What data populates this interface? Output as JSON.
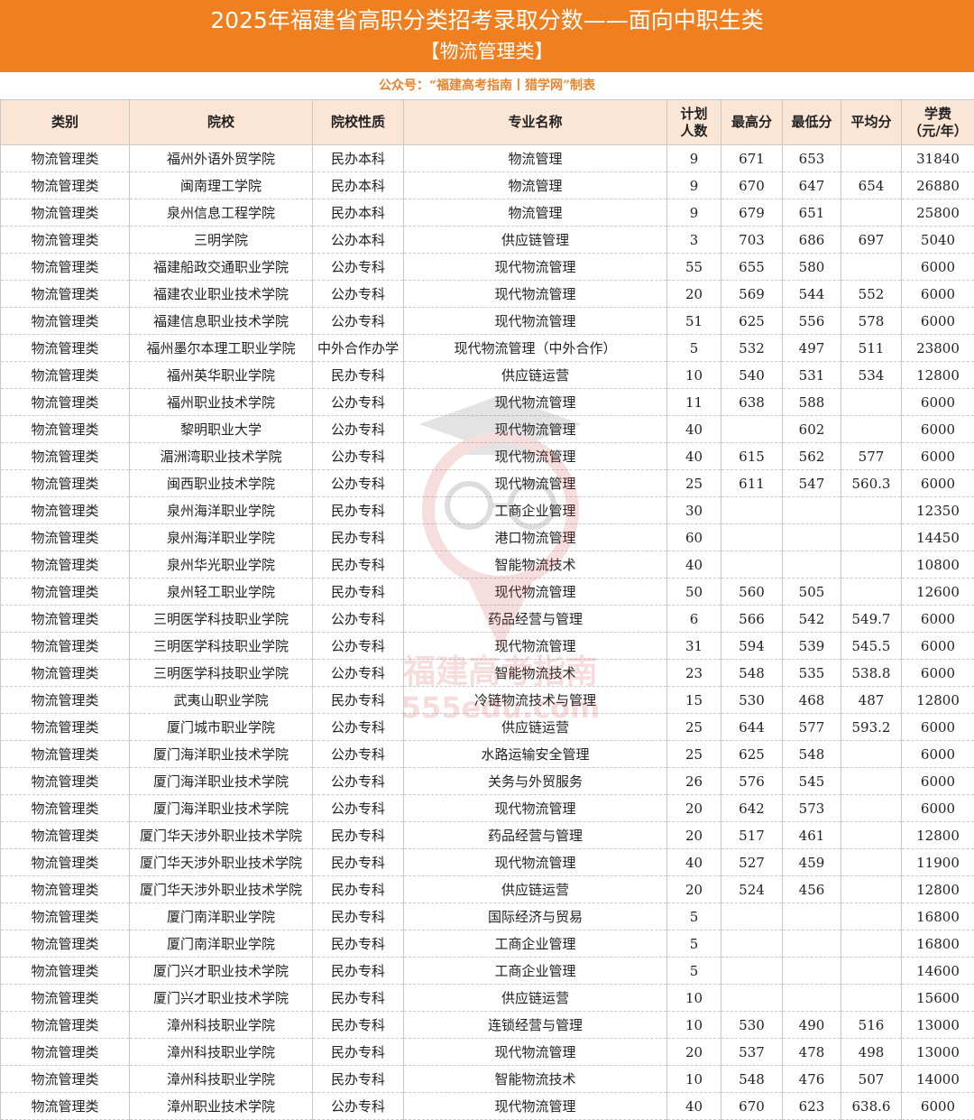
{
  "banner": {
    "title": "2025年福建省高职分类招考录取分数——面向中职生类",
    "subtitle": "【物流管理类】"
  },
  "credit": "公众号：“福建高考指南丨猎学网”制表",
  "watermark": {
    "line1": "福建高考指南",
    "line2": "555edu.com"
  },
  "table": {
    "headers": [
      "类别",
      "院校",
      "院校性质",
      "专业名称",
      "计划\n人数",
      "最高分",
      "最低分",
      "平均分",
      "学费\n（元/年）"
    ],
    "rows": [
      [
        "物流管理类",
        "福州外语外贸学院",
        "民办本科",
        "物流管理",
        "9",
        "671",
        "653",
        "",
        "31840"
      ],
      [
        "物流管理类",
        "闽南理工学院",
        "民办本科",
        "物流管理",
        "9",
        "670",
        "647",
        "654",
        "26880"
      ],
      [
        "物流管理类",
        "泉州信息工程学院",
        "民办本科",
        "物流管理",
        "9",
        "679",
        "651",
        "",
        "25800"
      ],
      [
        "物流管理类",
        "三明学院",
        "公办本科",
        "供应链管理",
        "3",
        "703",
        "686",
        "697",
        "5040"
      ],
      [
        "物流管理类",
        "福建船政交通职业学院",
        "公办专科",
        "现代物流管理",
        "55",
        "655",
        "580",
        "",
        "6000"
      ],
      [
        "物流管理类",
        "福建农业职业技术学院",
        "公办专科",
        "现代物流管理",
        "20",
        "569",
        "544",
        "552",
        "6000"
      ],
      [
        "物流管理类",
        "福建信息职业技术学院",
        "公办专科",
        "现代物流管理",
        "51",
        "625",
        "556",
        "578",
        "6000"
      ],
      [
        "物流管理类",
        "福州墨尔本理工职业学院",
        "中外合作办学",
        "现代物流管理（中外合作）",
        "5",
        "532",
        "497",
        "511",
        "23800"
      ],
      [
        "物流管理类",
        "福州英华职业学院",
        "民办专科",
        "供应链运营",
        "10",
        "540",
        "531",
        "534",
        "12800"
      ],
      [
        "物流管理类",
        "福州职业技术学院",
        "公办专科",
        "现代物流管理",
        "11",
        "638",
        "588",
        "",
        "6000"
      ],
      [
        "物流管理类",
        "黎明职业大学",
        "公办专科",
        "现代物流管理",
        "40",
        "",
        "602",
        "",
        "6000"
      ],
      [
        "物流管理类",
        "湄洲湾职业技术学院",
        "公办专科",
        "现代物流管理",
        "40",
        "615",
        "562",
        "577",
        "6000"
      ],
      [
        "物流管理类",
        "闽西职业技术学院",
        "公办专科",
        "现代物流管理",
        "25",
        "611",
        "547",
        "560.3",
        "6000"
      ],
      [
        "物流管理类",
        "泉州海洋职业学院",
        "民办专科",
        "工商企业管理",
        "30",
        "",
        "",
        "",
        "12350"
      ],
      [
        "物流管理类",
        "泉州海洋职业学院",
        "民办专科",
        "港口物流管理",
        "60",
        "",
        "",
        "",
        "14450"
      ],
      [
        "物流管理类",
        "泉州华光职业学院",
        "民办专科",
        "智能物流技术",
        "40",
        "",
        "",
        "",
        "10800"
      ],
      [
        "物流管理类",
        "泉州轻工职业学院",
        "民办专科",
        "现代物流管理",
        "50",
        "560",
        "505",
        "",
        "12600"
      ],
      [
        "物流管理类",
        "三明医学科技职业学院",
        "公办专科",
        "药品经营与管理",
        "6",
        "566",
        "542",
        "549.7",
        "6000"
      ],
      [
        "物流管理类",
        "三明医学科技职业学院",
        "公办专科",
        "现代物流管理",
        "31",
        "594",
        "539",
        "545.5",
        "6000"
      ],
      [
        "物流管理类",
        "三明医学科技职业学院",
        "公办专科",
        "智能物流技术",
        "23",
        "548",
        "535",
        "538.8",
        "6000"
      ],
      [
        "物流管理类",
        "武夷山职业学院",
        "民办专科",
        "冷链物流技术与管理",
        "15",
        "530",
        "468",
        "487",
        "12800"
      ],
      [
        "物流管理类",
        "厦门城市职业学院",
        "公办专科",
        "供应链运营",
        "25",
        "644",
        "577",
        "593.2",
        "6000"
      ],
      [
        "物流管理类",
        "厦门海洋职业技术学院",
        "公办专科",
        "水路运输安全管理",
        "25",
        "625",
        "548",
        "",
        "6000"
      ],
      [
        "物流管理类",
        "厦门海洋职业技术学院",
        "公办专科",
        "关务与外贸服务",
        "26",
        "576",
        "545",
        "",
        "6000"
      ],
      [
        "物流管理类",
        "厦门海洋职业技术学院",
        "公办专科",
        "现代物流管理",
        "20",
        "642",
        "573",
        "",
        "6000"
      ],
      [
        "物流管理类",
        "厦门华天涉外职业技术学院",
        "民办专科",
        "药品经营与管理",
        "20",
        "517",
        "461",
        "",
        "12800"
      ],
      [
        "物流管理类",
        "厦门华天涉外职业技术学院",
        "民办专科",
        "现代物流管理",
        "40",
        "527",
        "459",
        "",
        "11900"
      ],
      [
        "物流管理类",
        "厦门华天涉外职业技术学院",
        "民办专科",
        "供应链运营",
        "20",
        "524",
        "456",
        "",
        "12800"
      ],
      [
        "物流管理类",
        "厦门南洋职业学院",
        "民办专科",
        "国际经济与贸易",
        "5",
        "",
        "",
        "",
        "16800"
      ],
      [
        "物流管理类",
        "厦门南洋职业学院",
        "民办专科",
        "工商企业管理",
        "5",
        "",
        "",
        "",
        "16800"
      ],
      [
        "物流管理类",
        "厦门兴才职业技术学院",
        "民办专科",
        "工商企业管理",
        "5",
        "",
        "",
        "",
        "14600"
      ],
      [
        "物流管理类",
        "厦门兴才职业技术学院",
        "民办专科",
        "供应链运营",
        "10",
        "",
        "",
        "",
        "15600"
      ],
      [
        "物流管理类",
        "漳州科技职业学院",
        "民办专科",
        "连锁经营与管理",
        "10",
        "530",
        "490",
        "516",
        "13000"
      ],
      [
        "物流管理类",
        "漳州科技职业学院",
        "民办专科",
        "现代物流管理",
        "20",
        "537",
        "478",
        "498",
        "13000"
      ],
      [
        "物流管理类",
        "漳州科技职业学院",
        "民办专科",
        "智能物流技术",
        "10",
        "548",
        "476",
        "507",
        "14000"
      ],
      [
        "物流管理类",
        "漳州职业技术学院",
        "公办专科",
        "现代物流管理",
        "40",
        "670",
        "623",
        "638.6",
        "6000"
      ]
    ]
  }
}
